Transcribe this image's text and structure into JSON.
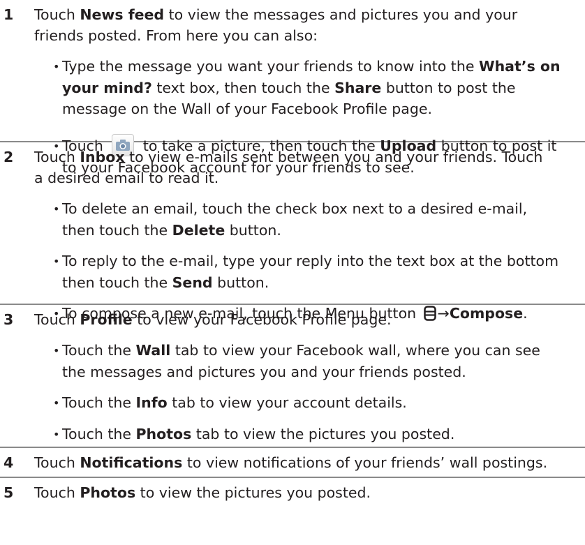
{
  "items": [
    {
      "number": "1",
      "intro": [
        "Touch ",
        "News feed",
        " to view the messages and pictures you and your",
        "friends posted. From here you can also:"
      ],
      "bullets": [
        [
          "Type the message you want your friends to know into the ",
          "What’s on",
          "your mind?",
          " text box, then touch the ",
          "Share",
          " button to post the",
          "message on the Wall of your Facebook Profile page."
        ],
        [
          "Touch ",
          " to take a picture, then touch the ",
          "Upload",
          " button to post it",
          "to your Facebook account for your friends to see."
        ]
      ]
    },
    {
      "number": "2",
      "intro": [
        "Touch ",
        "Inbox",
        " to view e-mails sent between you and your friends. Touch",
        "a desired email to read it."
      ],
      "bullets": [
        [
          "To delete an email, touch the check box next to a desired e-mail,",
          "then touch the ",
          "Delete",
          " button."
        ],
        [
          "To reply to the e-mail, type your reply into the text box at the bottom",
          "then touch the ",
          "Send",
          " button."
        ],
        [
          "To compose a new e-mail, touch the Menu button ",
          "→",
          "Compose",
          "."
        ]
      ]
    },
    {
      "number": "3",
      "intro": [
        "Touch ",
        "Profile",
        " to view your Facebook Profile page."
      ],
      "bullets": [
        [
          "Touch the ",
          "Wall",
          " tab to view your Facebook wall, where you can see",
          "the messages and pictures you and your friends posted."
        ],
        [
          "Touch the ",
          "Info",
          " tab to view your account details."
        ],
        [
          "Touch the ",
          "Photos",
          " tab to view the pictures you posted."
        ]
      ]
    },
    {
      "number": "4",
      "intro": [
        "Touch ",
        "Notifications",
        " to view notifications of your friends’ wall postings."
      ]
    },
    {
      "number": "5",
      "intro": [
        "Touch ",
        "Photos",
        " to view the pictures you posted."
      ]
    }
  ],
  "bullet_char": "•",
  "icons": {
    "camera": "camera-icon",
    "menu": "menu-icon"
  }
}
